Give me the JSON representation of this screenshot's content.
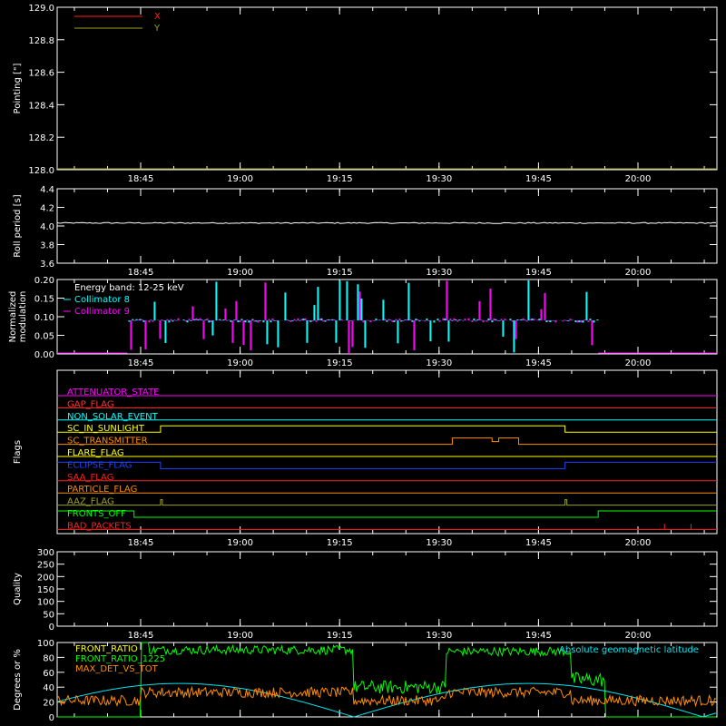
{
  "time_ticks": [
    "18:45",
    "19:00",
    "19:15",
    "19:30",
    "19:45",
    "20:00"
  ],
  "chart_data": [
    {
      "id": "pointing",
      "type": "line",
      "ylabel": "Pointing [\"]",
      "ylim": [
        128.0,
        129.0
      ],
      "yticks": [
        "129.0",
        "128.8",
        "128.6",
        "128.4",
        "128.2",
        "128.0"
      ],
      "legend": [
        {
          "name": "X",
          "color": "#ff2020"
        },
        {
          "name": "Y",
          "color": "#a0a020"
        }
      ],
      "series": [
        {
          "name": "Y",
          "color": "#a0a020",
          "value": 128.0
        }
      ]
    },
    {
      "id": "roll",
      "type": "line",
      "ylabel": "Roll period [s]",
      "ylim": [
        3.5,
        4.5
      ],
      "yticks": [
        "4.4",
        "4.2",
        "4.0",
        "3.8",
        "3.6"
      ],
      "series": [
        {
          "name": "Roll period",
          "color": "#ffffff",
          "value": 4.04
        }
      ]
    },
    {
      "id": "modulation",
      "type": "line",
      "ylabel": [
        "Normalized",
        "modulation"
      ],
      "ylim": [
        0.0,
        0.2
      ],
      "yticks": [
        "0.20",
        "0.15",
        "0.10",
        "0.05",
        "0.00"
      ],
      "annotation": "Energy band: 12-25 keV",
      "legend": [
        {
          "name": "Collimator 8",
          "color": "#00ffff"
        },
        {
          "name": "Collimator 9",
          "color": "#ff00ff"
        }
      ],
      "active_range": [
        "18:43",
        "19:54"
      ],
      "baseline": 0.09
    },
    {
      "id": "flags",
      "type": "line",
      "ylabel": "Flags",
      "flags": [
        {
          "name": "ATTENUATOR_STATE",
          "color": "#ff00ff"
        },
        {
          "name": "GAP_FLAG",
          "color": "#ff3030"
        },
        {
          "name": "NON_SOLAR_EVENT",
          "color": "#00ffff"
        },
        {
          "name": "SC_IN_SUNLIGHT",
          "color": "#ffff00"
        },
        {
          "name": "SC_TRANSMITTER",
          "color": "#ff8c00"
        },
        {
          "name": "FLARE_FLAG",
          "color": "#ffff00"
        },
        {
          "name": "ECLIPSE_FLAG",
          "color": "#2040ff"
        },
        {
          "name": "SAA_FLAG",
          "color": "#ff2020"
        },
        {
          "name": "PARTICLE_FLAG",
          "color": "#ff8c00"
        },
        {
          "name": "AAZ_FLAG",
          "color": "#a0a020"
        },
        {
          "name": "FRONTS_OFF",
          "color": "#00ff00"
        },
        {
          "name": "BAD_PACKETS",
          "color": "#ff2020"
        }
      ]
    },
    {
      "id": "quality",
      "type": "line",
      "ylabel": "Quality",
      "ylim": [
        0,
        300
      ],
      "yticks": [
        "300",
        "250",
        "200",
        "150",
        "100",
        "50",
        "0"
      ]
    },
    {
      "id": "front",
      "type": "line",
      "ylabel": "Degrees or %",
      "ylim": [
        0,
        100
      ],
      "yticks": [
        "100",
        "80",
        "60",
        "40",
        "20",
        "0"
      ],
      "legend": [
        {
          "name": "FRONT_RATIO",
          "color": "#ffff00"
        },
        {
          "name": "FRONT_RATIO_1225",
          "color": "#00ff00"
        },
        {
          "name": "MAX_DET_VS_TOT",
          "color": "#ff8c00"
        }
      ],
      "annotation": "Absolute geomagnetic latitude",
      "annotation_color": "#00e5ee"
    }
  ]
}
